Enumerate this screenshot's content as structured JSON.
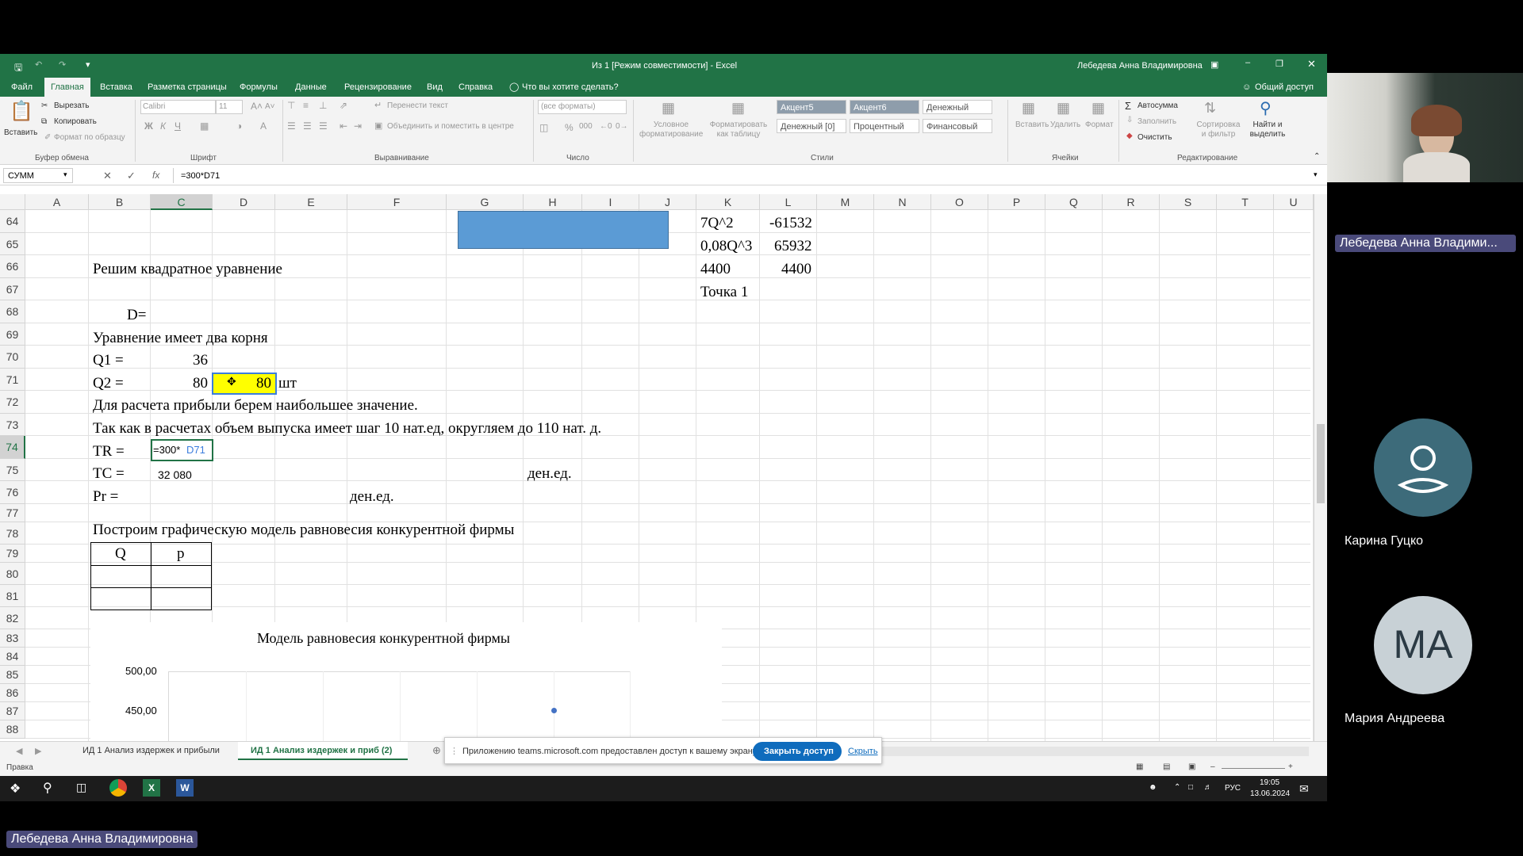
{
  "excel": {
    "title": "Из 1  [Режим совместимости]  -  Excel",
    "user": "Лебедева Анна Владимировна",
    "menu_tabs": [
      "Файл",
      "Главная",
      "Вставка",
      "Разметка страницы",
      "Формулы",
      "Данные",
      "Рецензирование",
      "Вид",
      "Справка",
      "Что вы хотите сделать?"
    ],
    "share_label": "Общий доступ",
    "ribbon": {
      "paste": "Вставить",
      "cut": "Вырезать",
      "copy": "Копировать",
      "format_painter": "Формат по образцу",
      "clipboard_group": "Буфер обмена",
      "font_name": "Calibri",
      "font_size": "11",
      "font_group": "Шрифт",
      "wrap_text": "Перенести текст",
      "merge_center": "Объединить и поместить в центре",
      "alignment_group": "Выравнивание",
      "number_format": "(все форматы)",
      "number_group": "Число",
      "conditional": "Условное форматирование",
      "format_table": "Форматировать как таблицу",
      "styles": [
        "Акцент5",
        "Акцент6",
        "Денежный",
        "Денежный [0]",
        "Процентный",
        "Финансовый"
      ],
      "styles_group": "Стили",
      "insert": "Вставить",
      "delete": "Удалить",
      "format": "Формат",
      "cells_group": "Ячейки",
      "autosum": "Автосумма",
      "fill": "Заполнить",
      "clear": "Очистить",
      "sort_filter": "Сортировка и фильтр",
      "find_select": "Найти и выделить",
      "editing_group": "Редактирование"
    },
    "name_box": "СУММ",
    "formula": "=300*D71",
    "columns": [
      "A",
      "B",
      "C",
      "D",
      "E",
      "F",
      "G",
      "H",
      "I",
      "J",
      "K",
      "L",
      "M",
      "N",
      "O",
      "P",
      "Q",
      "R",
      "S",
      "T",
      "U"
    ],
    "rows": [
      "64",
      "65",
      "66",
      "67",
      "68",
      "69",
      "70",
      "71",
      "72",
      "73",
      "74",
      "75",
      "76",
      "77",
      "78",
      "79",
      "80",
      "81",
      "82",
      "83",
      "84",
      "85",
      "86",
      "87",
      "88"
    ],
    "cells": {
      "k64": "7Q^2",
      "l64": "-61532",
      "k65": "0,08Q^3",
      "l65": "65932",
      "b66": "Решим квадратное уравнение",
      "k66": "4400",
      "l66": "4400",
      "k67": "Точка 1",
      "b68": "D=",
      "b69": "Уравнение имеет два корня",
      "b70": "Q1 =",
      "c70": "36",
      "b71": "Q2 =",
      "c71": "80",
      "d71": "80",
      "e71": "шт",
      "b72": "Для расчета прибыли берем наибольшее значение.",
      "b73": "Так как в расчетах объем выпуска имеет шаг 10 нат.ед, округляем до 110 нат. д.",
      "b74": "TR =",
      "c74_prefix": "=300*",
      "c74_ref": "D71",
      "b75": "TC =",
      "c75": "32 080",
      "h75": "ден.ед.",
      "b76": "Pr =",
      "f76": "ден.ед.",
      "b78": "Построим графическую модель равновесия конкурентной фирмы",
      "b80": "Q",
      "c80": "p"
    },
    "chart": {
      "title": "Модель равновесия конкурентной фирмы",
      "y_ticks": [
        "500,00",
        "450,00"
      ]
    },
    "sheet_tabs": [
      "ИД 1 Анализ издержек и прибыли",
      "ИД 1 Анализ издержек и приб (2)"
    ],
    "status": "Правка",
    "share_notice": {
      "text": "Приложению teams.microsoft.com предоставлен доступ к вашему экрану.",
      "stop_button": "Закрыть доступ",
      "hide_link": "Скрыть"
    },
    "taskbar": {
      "lang": "РУС",
      "time": "19:05",
      "date": "13.06.2024"
    }
  },
  "teams": {
    "presenter_tag": "Лебедева Анна Владими...",
    "participants": [
      {
        "name": "Карина Гуцко",
        "avatar": "person-icon",
        "color": "#3d6b7a"
      },
      {
        "name": "Мария Андреева",
        "initials": "МА",
        "color": "#c8d1d6"
      }
    ],
    "self_tag": "Лебедева Анна Владимировна"
  },
  "colors": {
    "excel_green": "#217346",
    "selected_fill": "#ffff00",
    "blue_shape": "#5b9bd5",
    "stop_button": "#0f6cbd"
  }
}
